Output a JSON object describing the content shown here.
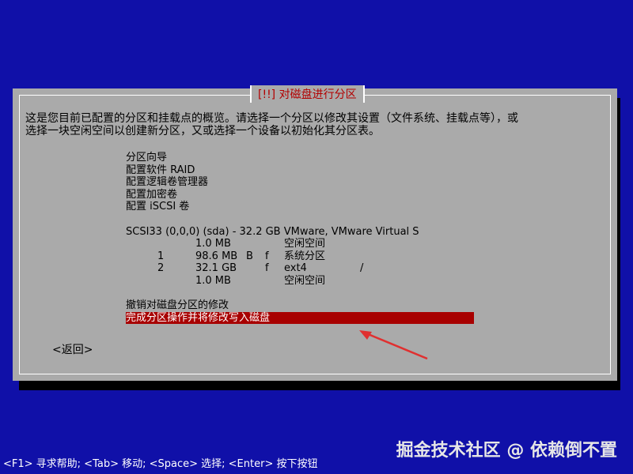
{
  "dialog": {
    "title": "[!!] 对磁盘进行分区",
    "description": [
      "这是您目前已配置的分区和挂载点的概览。请选择一个分区以修改其设置（文件系统、挂载点等），或",
      "选择一块空闲空间以创建新分区，又或选择一个设备以初始化其分区表。"
    ],
    "menu": [
      "分区向导",
      "配置软件 RAID",
      "配置逻辑卷管理器",
      "配置加密卷",
      "配置 iSCSI 卷"
    ],
    "disk": "SCSI33 (0,0,0) (sda) - 32.2 GB VMware, VMware Virtual S",
    "partitions": [
      {
        "num": "",
        "size": "1.0 MB",
        "flag1": "",
        "flag2": "",
        "type": "空闲空间",
        "mount": ""
      },
      {
        "num": "1",
        "size": "98.6 MB",
        "flag1": "B",
        "flag2": "f",
        "type": "系统分区",
        "mount": ""
      },
      {
        "num": "2",
        "size": "32.1 GB",
        "flag1": "",
        "flag2": "f",
        "type": "ext4",
        "mount": "/"
      },
      {
        "num": "",
        "size": "1.0 MB",
        "flag1": "",
        "flag2": "",
        "type": "空闲空间",
        "mount": ""
      }
    ],
    "undo": "撤销对磁盘分区的修改",
    "finish": "完成分区操作并将修改写入磁盘",
    "back": "<返回>"
  },
  "status_bar": "<F1> 寻求帮助; <Tab> 移动; <Space> 选择; <Enter> 按下按钮",
  "watermark": "掘金技术社区 @ 依赖倒不置",
  "colors": {
    "background": "#1010a8",
    "dialog": "#aaaaaa",
    "highlight": "#a80000",
    "title": "#b30000",
    "arrow": "#e03030"
  }
}
